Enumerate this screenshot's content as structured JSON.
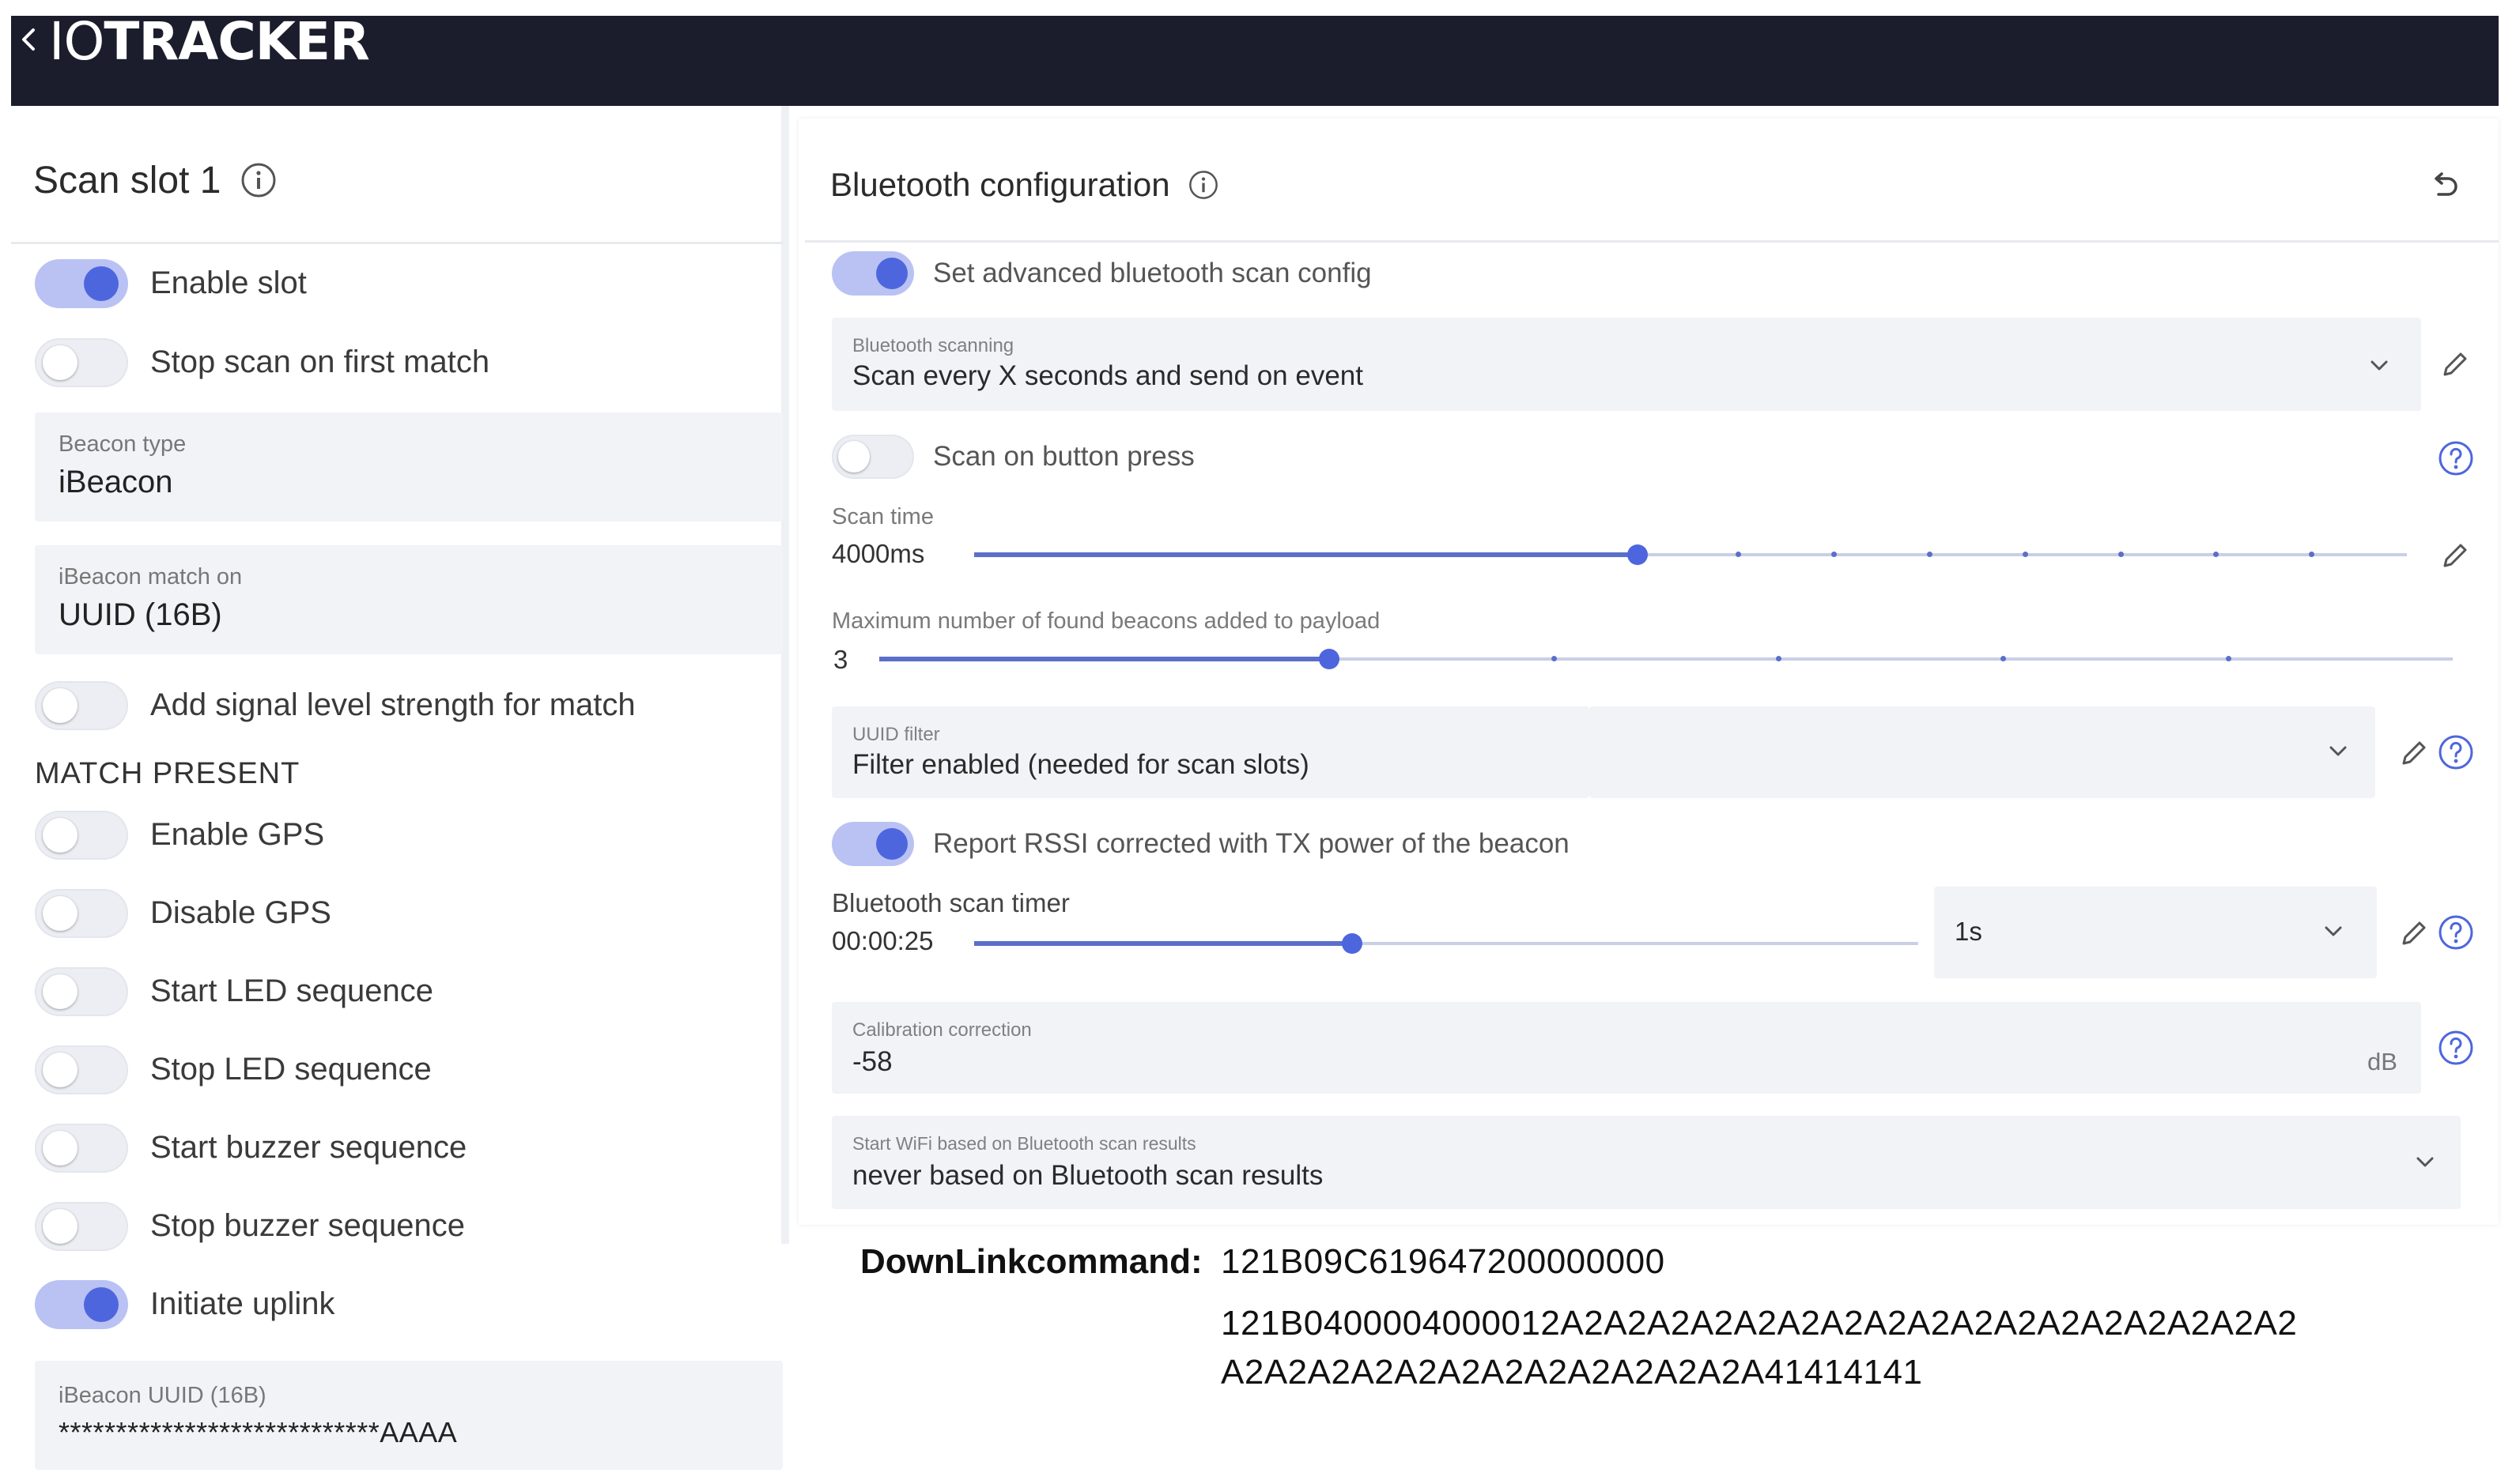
{
  "header": {
    "logo_thin": "IO",
    "logo_bold": "TRACKER"
  },
  "left": {
    "title": "Scan slot 1",
    "toggles_top": [
      {
        "label": "Enable slot",
        "on": true
      },
      {
        "label": "Stop scan on first match",
        "on": false
      }
    ],
    "beacon_type": {
      "label": "Beacon type",
      "value": "iBeacon"
    },
    "match_on": {
      "label": "iBeacon match on",
      "value": "UUID (16B)"
    },
    "signal_toggle": {
      "label": "Add signal level strength for match",
      "on": false
    },
    "section": "MATCH PRESENT",
    "toggles_match": [
      {
        "label": "Enable GPS",
        "on": false
      },
      {
        "label": "Disable GPS",
        "on": false
      },
      {
        "label": "Start LED sequence",
        "on": false
      },
      {
        "label": "Stop LED sequence",
        "on": false
      },
      {
        "label": "Start buzzer sequence",
        "on": false
      },
      {
        "label": "Stop buzzer sequence",
        "on": false
      },
      {
        "label": "Initiate uplink",
        "on": true
      }
    ],
    "uuid": {
      "label": "iBeacon UUID (16B)",
      "value": "****************************AAAA"
    }
  },
  "right": {
    "title": "Bluetooth configuration",
    "advanced": {
      "label": "Set advanced bluetooth scan config",
      "on": true
    },
    "scanning": {
      "label": "Bluetooth scanning",
      "value": "Scan every X seconds and send on event"
    },
    "button_press": {
      "label": "Scan on button press",
      "on": false
    },
    "scan_time": {
      "label": "Scan time",
      "value": "4000ms",
      "fraction": 0.463,
      "steps": 15
    },
    "max_beacons": {
      "label": "Maximum number of found beacons added to payload",
      "value": "3",
      "fraction": 0.286,
      "steps": 7
    },
    "uuid_filter": {
      "label": "UUID filter",
      "value": "Filter enabled (needed for scan slots)"
    },
    "rssi": {
      "label": "Report RSSI corrected with TX power of the beacon",
      "on": true
    },
    "scan_timer": {
      "label": "Bluetooth scan timer",
      "value": "00:00:25",
      "fraction": 0.4,
      "unit": "1s"
    },
    "calibration": {
      "label": "Calibration correction",
      "value": "-58",
      "unit": "dB"
    },
    "wifi": {
      "label": "Start WiFi based on Bluetooth scan results",
      "value": "never based on Bluetooth scan results"
    }
  },
  "downlink": {
    "label": "DownLinkcommand:",
    "line1": "121B09C619647200000000",
    "line2": "121B0400004000012A2A2A2A2A2A2A2A2A2A2A2A2A2A2A2A2A2",
    "line3": "A2A2A2A2A2A2A2A2A2A2A2A2A41414141"
  },
  "colors": {
    "header_bg": "#1b1d2c",
    "accent": "#4e66dd",
    "accent_light": "#b9c2f3",
    "field_bg": "#f2f3f7"
  },
  "icons": [
    "back-chevron-icon",
    "info-icon",
    "reset-icon",
    "chevron-down-icon",
    "pencil-icon",
    "help-circle-icon"
  ]
}
